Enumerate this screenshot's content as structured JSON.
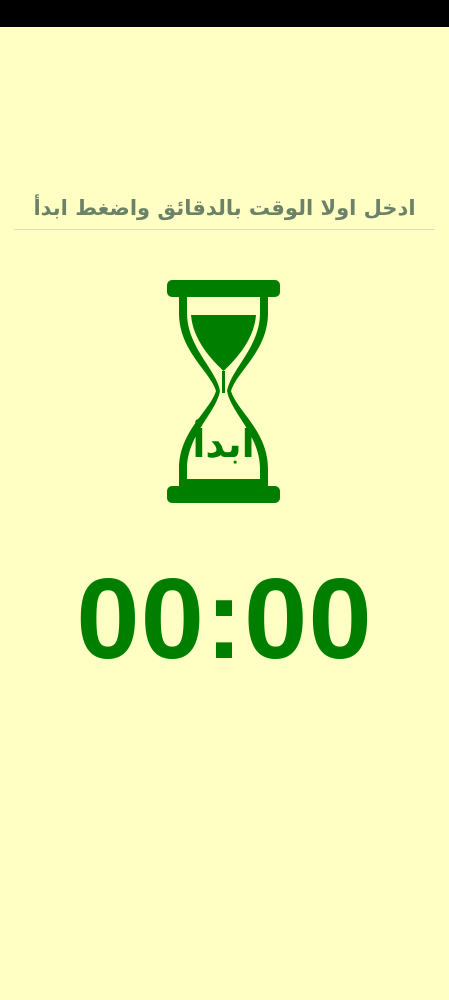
{
  "instruction": {
    "text": "ادخل اولا الوقت بالدقائق واضغط ابدأ"
  },
  "start_button": {
    "label": "ابدأ",
    "icon": "hourglass-icon"
  },
  "timer": {
    "display": "00:00"
  },
  "colors": {
    "background": "#ffffc4",
    "accent": "#007e00",
    "hint_text": "#6c8268",
    "status_bar": "#000000"
  }
}
